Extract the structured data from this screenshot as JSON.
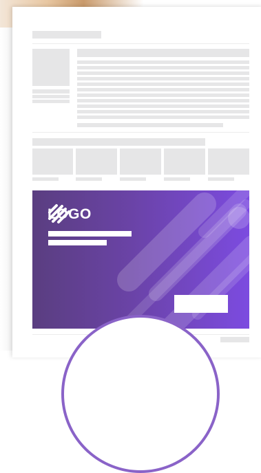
{
  "banner": {
    "logo_text": "LOGO",
    "logo_icon": "stripes-logo-icon",
    "gradient_start": "#5a3e80",
    "gradient_end": "#7c4be0"
  },
  "colors": {
    "placeholder_gray": "#e6e6e7",
    "accent_purple": "#8a63c8"
  }
}
